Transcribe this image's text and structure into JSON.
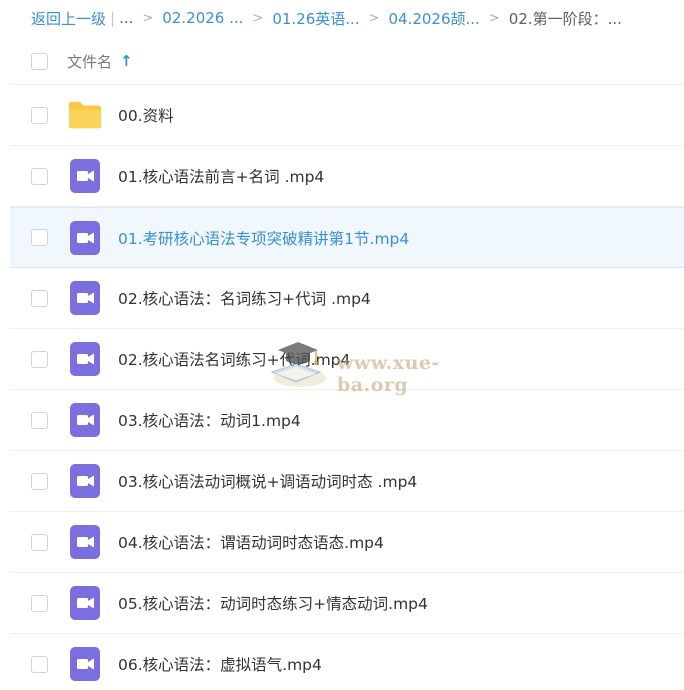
{
  "breadcrumb": {
    "back_label": "返回上一级",
    "separator": "|",
    "ellipsis": "...",
    "arrow": ">",
    "crumbs": [
      "02.2026 ...",
      "01.26英语...",
      "04.2026颉...",
      "02.第一阶段：..."
    ]
  },
  "header": {
    "column_title": "文件名",
    "sort_symbol": "↑"
  },
  "files": [
    {
      "name": "00.资料",
      "type": "folder",
      "selected": false
    },
    {
      "name": "01.核心语法前言+名词 .mp4",
      "type": "video",
      "selected": false
    },
    {
      "name": "01.考研核心语法专项突破精讲第1节.mp4",
      "type": "video",
      "selected": true
    },
    {
      "name": "02.核心语法：名词练习+代词 .mp4",
      "type": "video",
      "selected": false
    },
    {
      "name": "02.核心语法名词练习+代词.mp4",
      "type": "video",
      "selected": false
    },
    {
      "name": "03.核心语法：动词1.mp4",
      "type": "video",
      "selected": false
    },
    {
      "name": "03.核心语法动词概说+调语动词时态 .mp4",
      "type": "video",
      "selected": false
    },
    {
      "name": "04.核心语法：谓语动词时态语态.mp4",
      "type": "video",
      "selected": false
    },
    {
      "name": "05.核心语法：动词时态练习+情态动词.mp4",
      "type": "video",
      "selected": false
    },
    {
      "name": "06.核心语法：虚拟语气.mp4",
      "type": "video",
      "selected": false
    }
  ],
  "watermark": {
    "text": "www.xue-ba.org",
    "icon": "graduation-cap-book-logo"
  },
  "colors": {
    "link": "#3a8fd9",
    "folder": "#f7c843",
    "video_icon": "#7b6fe0",
    "selected_row": "#f0f7fd"
  }
}
